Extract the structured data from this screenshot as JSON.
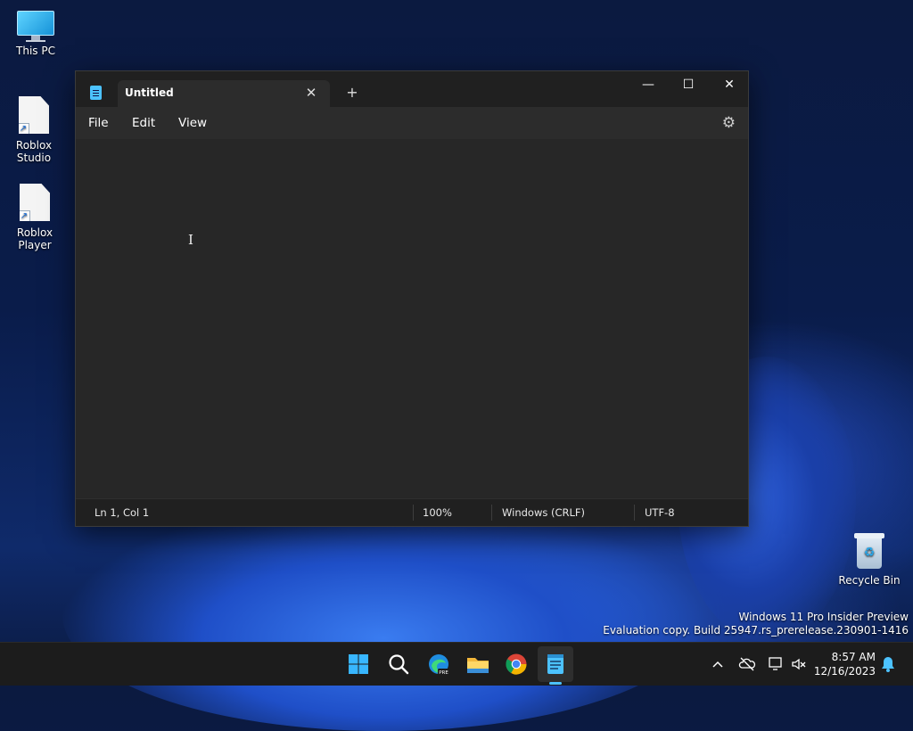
{
  "desktop": {
    "icons": [
      {
        "label": "This PC"
      },
      {
        "label": "Roblox Studio"
      },
      {
        "label": "Roblox Player"
      },
      {
        "label": "Recycle Bin"
      }
    ],
    "watermark": {
      "line1": "Windows 11 Pro Insider Preview",
      "line2": "Evaluation copy. Build 25947.rs_prerelease.230901-1416"
    }
  },
  "notepad": {
    "tab_title": "Untitled",
    "tab_close": "✕",
    "new_tab": "+",
    "window_controls": {
      "minimize": "—",
      "maximize": "☐",
      "close": "✕"
    },
    "menu": [
      "File",
      "Edit",
      "View"
    ],
    "settings_icon": "⚙",
    "cursor_glyph": "I",
    "status": {
      "position": "Ln 1, Col 1",
      "zoom": "100%",
      "line_ending": "Windows (CRLF)",
      "encoding": "UTF-8"
    }
  },
  "taskbar": {
    "tray_chevron": "^",
    "clock_time": "8:57 AM",
    "clock_date": "12/16/2023"
  },
  "colors": {
    "accent": "#4cc2ff",
    "window_bg": "#272727",
    "taskbar_bg": "#1c1c1c"
  }
}
